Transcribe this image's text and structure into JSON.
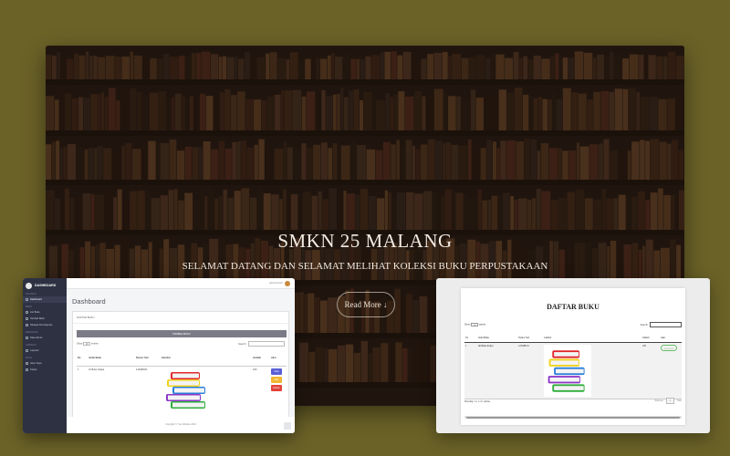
{
  "hero": {
    "title": "SMKN 25 MALANG",
    "subtitle": "SELAMAT DATANG DAN SELAMAT MELIHAT KOLEKSI BUKU PERPUSTAKAAN",
    "button_label": "Read More ↓"
  },
  "admin": {
    "brand": "DASHBOARD",
    "nav": [
      {
        "group": "HALAMAN",
        "items": [
          "Dashboard"
        ]
      },
      {
        "group": "MENU",
        "items": [
          "List Buku",
          "Tambah Buku",
          "Riwayat Peminjaman"
        ]
      },
      {
        "group": "PENGGUNA",
        "items": [
          "Data Admin"
        ]
      },
      {
        "group": "LAPORAN",
        "items": [
          "Laporan"
        ]
      },
      {
        "group": "AKUN",
        "items": [
          "Akun Saya",
          "Keluar"
        ]
      }
    ],
    "user_name": "administrator",
    "page_title": "Dashboard",
    "card_header": "DAFTAR BUKU",
    "add_button": "TAMBAH BUKU",
    "show_label": "Show",
    "entries_value": "10",
    "entries_label": "entries",
    "search_label": "Search:",
    "columns": [
      "No",
      "Judul Buku",
      "Nomor Seri",
      "Gambar",
      "Jumlah",
      "Aksi"
    ],
    "rows": [
      {
        "no": "1",
        "judul": "Ini Buku Kaliya",
        "seri": "123ABC01",
        "jumlah": "100"
      }
    ],
    "actions": {
      "view": "View",
      "edit": "Edit",
      "delete": "Delete"
    },
    "footer": "Copyright © Your Website 2023",
    "colors": {
      "view": "#5a5fd6",
      "edit": "#f2b733",
      "delete": "#e2433b"
    }
  },
  "public_table": {
    "title": "DAFTAR BUKU",
    "show_label": "Show",
    "entries_value": "10",
    "entries_label": "entries",
    "search_label": "Search:",
    "columns": [
      "No",
      "Judul Buku",
      "Nomor Seri",
      "Gambar",
      "Jumlah",
      "Aksi"
    ],
    "rows": [
      {
        "no": "1",
        "judul": "Ini Buku Kaliya",
        "seri": "123ABC01",
        "jumlah": "100",
        "aksi": "Download"
      }
    ],
    "info": "Showing 1 to 1 of 1 entries",
    "prev": "Previous",
    "page": "1",
    "next": "Next"
  }
}
